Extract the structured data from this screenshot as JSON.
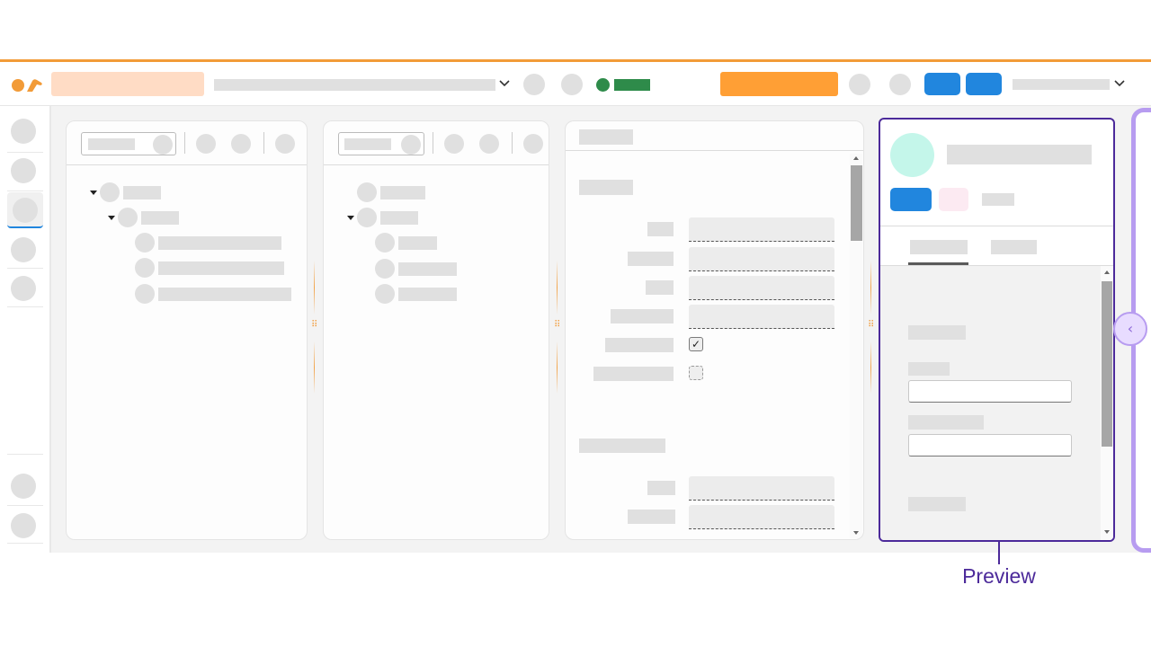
{
  "annotation": {
    "callout_label": "Preview"
  },
  "colors": {
    "brand_orange": "#f29b38",
    "primary_button": "#ff9f35",
    "blue_button": "#2186de",
    "status_green": "#2e8b4a",
    "preview_outline": "#4c2a9a",
    "frame_lavender": "#b79cf0",
    "avatar_mint": "#c4f6ea"
  },
  "icons": {
    "logo": "logo-icon",
    "dropdown": "chevron-down-icon",
    "tree_toggle": "caret-down-icon",
    "checkbox_checked": "check-icon",
    "panel_grip": "drag-handle-icon",
    "collapse": "chevron-left-icon"
  },
  "glyphs": {
    "check": "✓",
    "chevron_down": "⌄",
    "chevron_left": "‹",
    "grip": "⠿"
  }
}
